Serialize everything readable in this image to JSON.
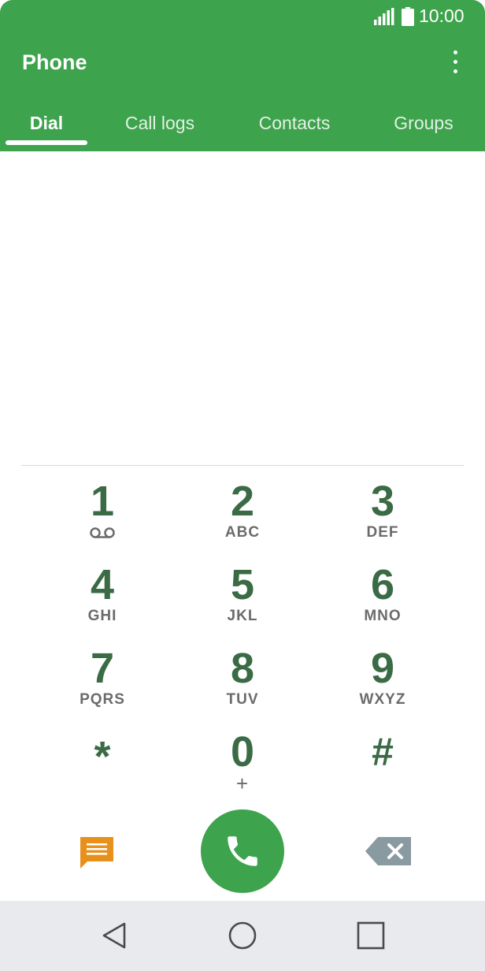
{
  "status_bar": {
    "time": "10:00",
    "signal_icon": "signal-icon",
    "battery_icon": "battery-icon"
  },
  "header": {
    "title": "Phone",
    "menu_icon": "more-vert-icon"
  },
  "tabs": [
    {
      "label": "Dial",
      "active": true
    },
    {
      "label": "Call logs",
      "active": false
    },
    {
      "label": "Contacts",
      "active": false
    },
    {
      "label": "Groups",
      "active": false
    }
  ],
  "dial_pad": {
    "keys": [
      {
        "digit": "1",
        "letters": "",
        "icon": "voicemail-icon"
      },
      {
        "digit": "2",
        "letters": "ABC"
      },
      {
        "digit": "3",
        "letters": "DEF"
      },
      {
        "digit": "4",
        "letters": "GHI"
      },
      {
        "digit": "5",
        "letters": "JKL"
      },
      {
        "digit": "6",
        "letters": "MNO"
      },
      {
        "digit": "7",
        "letters": "PQRS"
      },
      {
        "digit": "8",
        "letters": "TUV"
      },
      {
        "digit": "9",
        "letters": "WXYZ"
      },
      {
        "digit": "*",
        "letters": ""
      },
      {
        "digit": "0",
        "letters": "+"
      },
      {
        "digit": "#",
        "letters": ""
      }
    ]
  },
  "actions": {
    "message_icon": "message-icon",
    "call_icon": "phone-icon",
    "backspace_icon": "backspace-icon"
  },
  "colors": {
    "primary": "#3da34c",
    "digit": "#3a6b45",
    "message_accent": "#e8901c",
    "backspace": "#8a9aa1"
  },
  "nav_bar": {
    "back_icon": "back-triangle-icon",
    "home_icon": "home-circle-icon",
    "recents_icon": "recents-square-icon"
  }
}
